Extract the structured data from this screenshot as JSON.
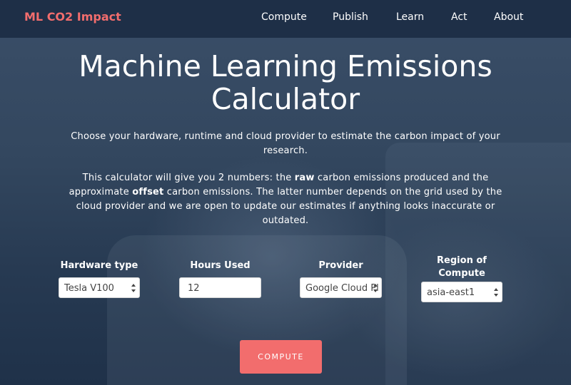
{
  "brand": "ML CO2 Impact",
  "nav": [
    "Compute",
    "Publish",
    "Learn",
    "Act",
    "About"
  ],
  "hero": {
    "title_line1": "Machine Learning Emissions",
    "title_line2": "Calculator",
    "desc1": "Choose your hardware, runtime and cloud provider to estimate the carbon impact of your research.",
    "desc2_a": "This calculator will give you 2 numbers: the ",
    "desc2_raw": "raw",
    "desc2_b": " carbon emissions produced and the approximate ",
    "desc2_offset": "offset",
    "desc2_c": " carbon emissions. The latter number depends on the grid used by the cloud provider and we are open to update our estimates if anything looks inaccurate or outdated."
  },
  "form": {
    "hardware_label": "Hardware type",
    "hardware_value": "Tesla V100",
    "hours_label": "Hours Used",
    "hours_value": "12",
    "provider_label": "Provider",
    "provider_value": "Google Cloud Pl",
    "region_label_1": "Region of",
    "region_label_2": "Compute",
    "region_value": "asia-east1"
  },
  "compute_button": "COMPUTE",
  "colors": {
    "accent": "#f26d6d",
    "navbar": "#1e2f47",
    "background": "#2d415a"
  }
}
